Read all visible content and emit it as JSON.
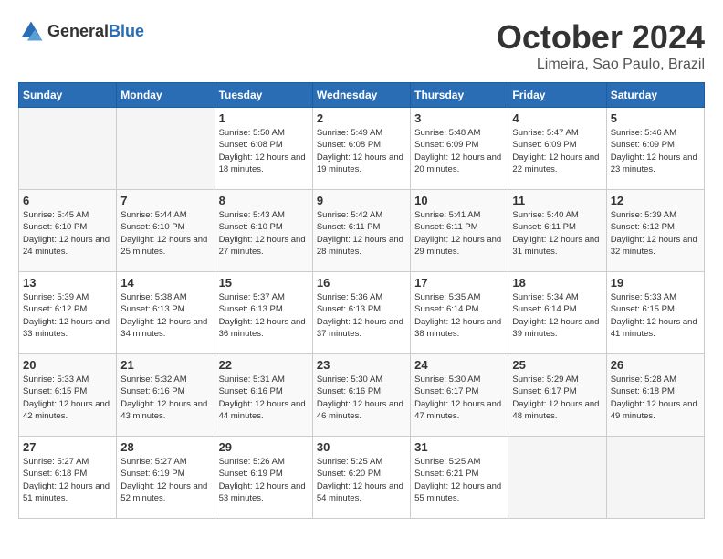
{
  "header": {
    "logo_general": "General",
    "logo_blue": "Blue",
    "month": "October 2024",
    "location": "Limeira, Sao Paulo, Brazil"
  },
  "days_of_week": [
    "Sunday",
    "Monday",
    "Tuesday",
    "Wednesday",
    "Thursday",
    "Friday",
    "Saturday"
  ],
  "weeks": [
    [
      {
        "day": "",
        "empty": true
      },
      {
        "day": "",
        "empty": true
      },
      {
        "day": "1",
        "sunrise": "Sunrise: 5:50 AM",
        "sunset": "Sunset: 6:08 PM",
        "daylight": "Daylight: 12 hours and 18 minutes."
      },
      {
        "day": "2",
        "sunrise": "Sunrise: 5:49 AM",
        "sunset": "Sunset: 6:08 PM",
        "daylight": "Daylight: 12 hours and 19 minutes."
      },
      {
        "day": "3",
        "sunrise": "Sunrise: 5:48 AM",
        "sunset": "Sunset: 6:09 PM",
        "daylight": "Daylight: 12 hours and 20 minutes."
      },
      {
        "day": "4",
        "sunrise": "Sunrise: 5:47 AM",
        "sunset": "Sunset: 6:09 PM",
        "daylight": "Daylight: 12 hours and 22 minutes."
      },
      {
        "day": "5",
        "sunrise": "Sunrise: 5:46 AM",
        "sunset": "Sunset: 6:09 PM",
        "daylight": "Daylight: 12 hours and 23 minutes."
      }
    ],
    [
      {
        "day": "6",
        "sunrise": "Sunrise: 5:45 AM",
        "sunset": "Sunset: 6:10 PM",
        "daylight": "Daylight: 12 hours and 24 minutes."
      },
      {
        "day": "7",
        "sunrise": "Sunrise: 5:44 AM",
        "sunset": "Sunset: 6:10 PM",
        "daylight": "Daylight: 12 hours and 25 minutes."
      },
      {
        "day": "8",
        "sunrise": "Sunrise: 5:43 AM",
        "sunset": "Sunset: 6:10 PM",
        "daylight": "Daylight: 12 hours and 27 minutes."
      },
      {
        "day": "9",
        "sunrise": "Sunrise: 5:42 AM",
        "sunset": "Sunset: 6:11 PM",
        "daylight": "Daylight: 12 hours and 28 minutes."
      },
      {
        "day": "10",
        "sunrise": "Sunrise: 5:41 AM",
        "sunset": "Sunset: 6:11 PM",
        "daylight": "Daylight: 12 hours and 29 minutes."
      },
      {
        "day": "11",
        "sunrise": "Sunrise: 5:40 AM",
        "sunset": "Sunset: 6:11 PM",
        "daylight": "Daylight: 12 hours and 31 minutes."
      },
      {
        "day": "12",
        "sunrise": "Sunrise: 5:39 AM",
        "sunset": "Sunset: 6:12 PM",
        "daylight": "Daylight: 12 hours and 32 minutes."
      }
    ],
    [
      {
        "day": "13",
        "sunrise": "Sunrise: 5:39 AM",
        "sunset": "Sunset: 6:12 PM",
        "daylight": "Daylight: 12 hours and 33 minutes."
      },
      {
        "day": "14",
        "sunrise": "Sunrise: 5:38 AM",
        "sunset": "Sunset: 6:13 PM",
        "daylight": "Daylight: 12 hours and 34 minutes."
      },
      {
        "day": "15",
        "sunrise": "Sunrise: 5:37 AM",
        "sunset": "Sunset: 6:13 PM",
        "daylight": "Daylight: 12 hours and 36 minutes."
      },
      {
        "day": "16",
        "sunrise": "Sunrise: 5:36 AM",
        "sunset": "Sunset: 6:13 PM",
        "daylight": "Daylight: 12 hours and 37 minutes."
      },
      {
        "day": "17",
        "sunrise": "Sunrise: 5:35 AM",
        "sunset": "Sunset: 6:14 PM",
        "daylight": "Daylight: 12 hours and 38 minutes."
      },
      {
        "day": "18",
        "sunrise": "Sunrise: 5:34 AM",
        "sunset": "Sunset: 6:14 PM",
        "daylight": "Daylight: 12 hours and 39 minutes."
      },
      {
        "day": "19",
        "sunrise": "Sunrise: 5:33 AM",
        "sunset": "Sunset: 6:15 PM",
        "daylight": "Daylight: 12 hours and 41 minutes."
      }
    ],
    [
      {
        "day": "20",
        "sunrise": "Sunrise: 5:33 AM",
        "sunset": "Sunset: 6:15 PM",
        "daylight": "Daylight: 12 hours and 42 minutes."
      },
      {
        "day": "21",
        "sunrise": "Sunrise: 5:32 AM",
        "sunset": "Sunset: 6:16 PM",
        "daylight": "Daylight: 12 hours and 43 minutes."
      },
      {
        "day": "22",
        "sunrise": "Sunrise: 5:31 AM",
        "sunset": "Sunset: 6:16 PM",
        "daylight": "Daylight: 12 hours and 44 minutes."
      },
      {
        "day": "23",
        "sunrise": "Sunrise: 5:30 AM",
        "sunset": "Sunset: 6:16 PM",
        "daylight": "Daylight: 12 hours and 46 minutes."
      },
      {
        "day": "24",
        "sunrise": "Sunrise: 5:30 AM",
        "sunset": "Sunset: 6:17 PM",
        "daylight": "Daylight: 12 hours and 47 minutes."
      },
      {
        "day": "25",
        "sunrise": "Sunrise: 5:29 AM",
        "sunset": "Sunset: 6:17 PM",
        "daylight": "Daylight: 12 hours and 48 minutes."
      },
      {
        "day": "26",
        "sunrise": "Sunrise: 5:28 AM",
        "sunset": "Sunset: 6:18 PM",
        "daylight": "Daylight: 12 hours and 49 minutes."
      }
    ],
    [
      {
        "day": "27",
        "sunrise": "Sunrise: 5:27 AM",
        "sunset": "Sunset: 6:18 PM",
        "daylight": "Daylight: 12 hours and 51 minutes."
      },
      {
        "day": "28",
        "sunrise": "Sunrise: 5:27 AM",
        "sunset": "Sunset: 6:19 PM",
        "daylight": "Daylight: 12 hours and 52 minutes."
      },
      {
        "day": "29",
        "sunrise": "Sunrise: 5:26 AM",
        "sunset": "Sunset: 6:19 PM",
        "daylight": "Daylight: 12 hours and 53 minutes."
      },
      {
        "day": "30",
        "sunrise": "Sunrise: 5:25 AM",
        "sunset": "Sunset: 6:20 PM",
        "daylight": "Daylight: 12 hours and 54 minutes."
      },
      {
        "day": "31",
        "sunrise": "Sunrise: 5:25 AM",
        "sunset": "Sunset: 6:21 PM",
        "daylight": "Daylight: 12 hours and 55 minutes."
      },
      {
        "day": "",
        "empty": true
      },
      {
        "day": "",
        "empty": true
      }
    ]
  ]
}
